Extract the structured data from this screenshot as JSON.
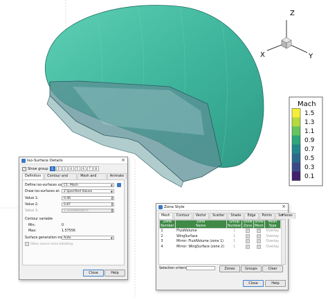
{
  "axes_triad": {
    "z_label": "Z",
    "y_label": "Y",
    "x_label": "X"
  },
  "legend": {
    "title": "Mach",
    "levels": [
      "1.5",
      "1.3",
      "1.1",
      "0.9",
      "0.7",
      "0.5",
      "0.3",
      "0.1"
    ],
    "colors": [
      "#f3ee3a",
      "#b5d93e",
      "#66c45f",
      "#2fa57b",
      "#22878a",
      "#2c6a8b",
      "#3b4a87",
      "#43206b"
    ]
  },
  "iso_dialog": {
    "title": "Iso-Surface Details",
    "show_group_label": "Show group",
    "groups": [
      "1",
      "2",
      "3",
      "4",
      "5",
      "6",
      "7",
      "8"
    ],
    "tabs": [
      "Definition",
      "Contour and Shade",
      "Mesh and Vector",
      "Animate"
    ],
    "define_label": "Define iso-surfaces using:",
    "define_value": "C1: Mach",
    "draw_label": "Draw iso-surfaces at:",
    "draw_value": "2 Specified Values",
    "value1_label": "Value 1:",
    "value1": "0.46",
    "value2_label": "Value 2:",
    "value2": "0.87",
    "value3_label": "Value 3:",
    "value3": "1.16160650075",
    "contour_variable_label": "Contour variable",
    "min_label": "Min:",
    "min_value": "0",
    "max_label": "Max:",
    "max_value": "1.57556",
    "method_label": "Surface generation method:",
    "method_value": "Auto",
    "obey_label": "Obey source zone blanking",
    "close_label": "Close",
    "help_label": "Help"
  },
  "zone_dialog": {
    "title": "Zone Style",
    "tabs": [
      "Mesh",
      "Contour",
      "Vector",
      "Scatter",
      "Shade",
      "Edge",
      "Points",
      "Surfaces"
    ],
    "headers": [
      [
        "Zone",
        "Number"
      ],
      [
        "Zone",
        "Name"
      ],
      [
        "Group",
        "Number"
      ],
      [
        "Show",
        "Zone"
      ],
      [
        "Show",
        "Mesh"
      ],
      [
        "Mesh",
        "Type"
      ]
    ],
    "rows": [
      {
        "num": "1",
        "name": "FluidVolume",
        "group": "1",
        "type": "Overlay"
      },
      {
        "num": "2",
        "name": "WingSurface",
        "group": "1",
        "type": "Overlay"
      },
      {
        "num": "3",
        "name": "Mirror: FluidVolume (zone 1)",
        "group": "1",
        "type": "Overlay"
      },
      {
        "num": "4",
        "name": "Mirror: WingSurface (zone 2)",
        "group": "1",
        "type": "Overlay"
      }
    ],
    "selection_label": "Selection criteria:",
    "zones_btn": "Zones",
    "groups_btn": "Groups",
    "clear_btn": "Clear",
    "close_label": "Close",
    "help_label": "Help"
  }
}
